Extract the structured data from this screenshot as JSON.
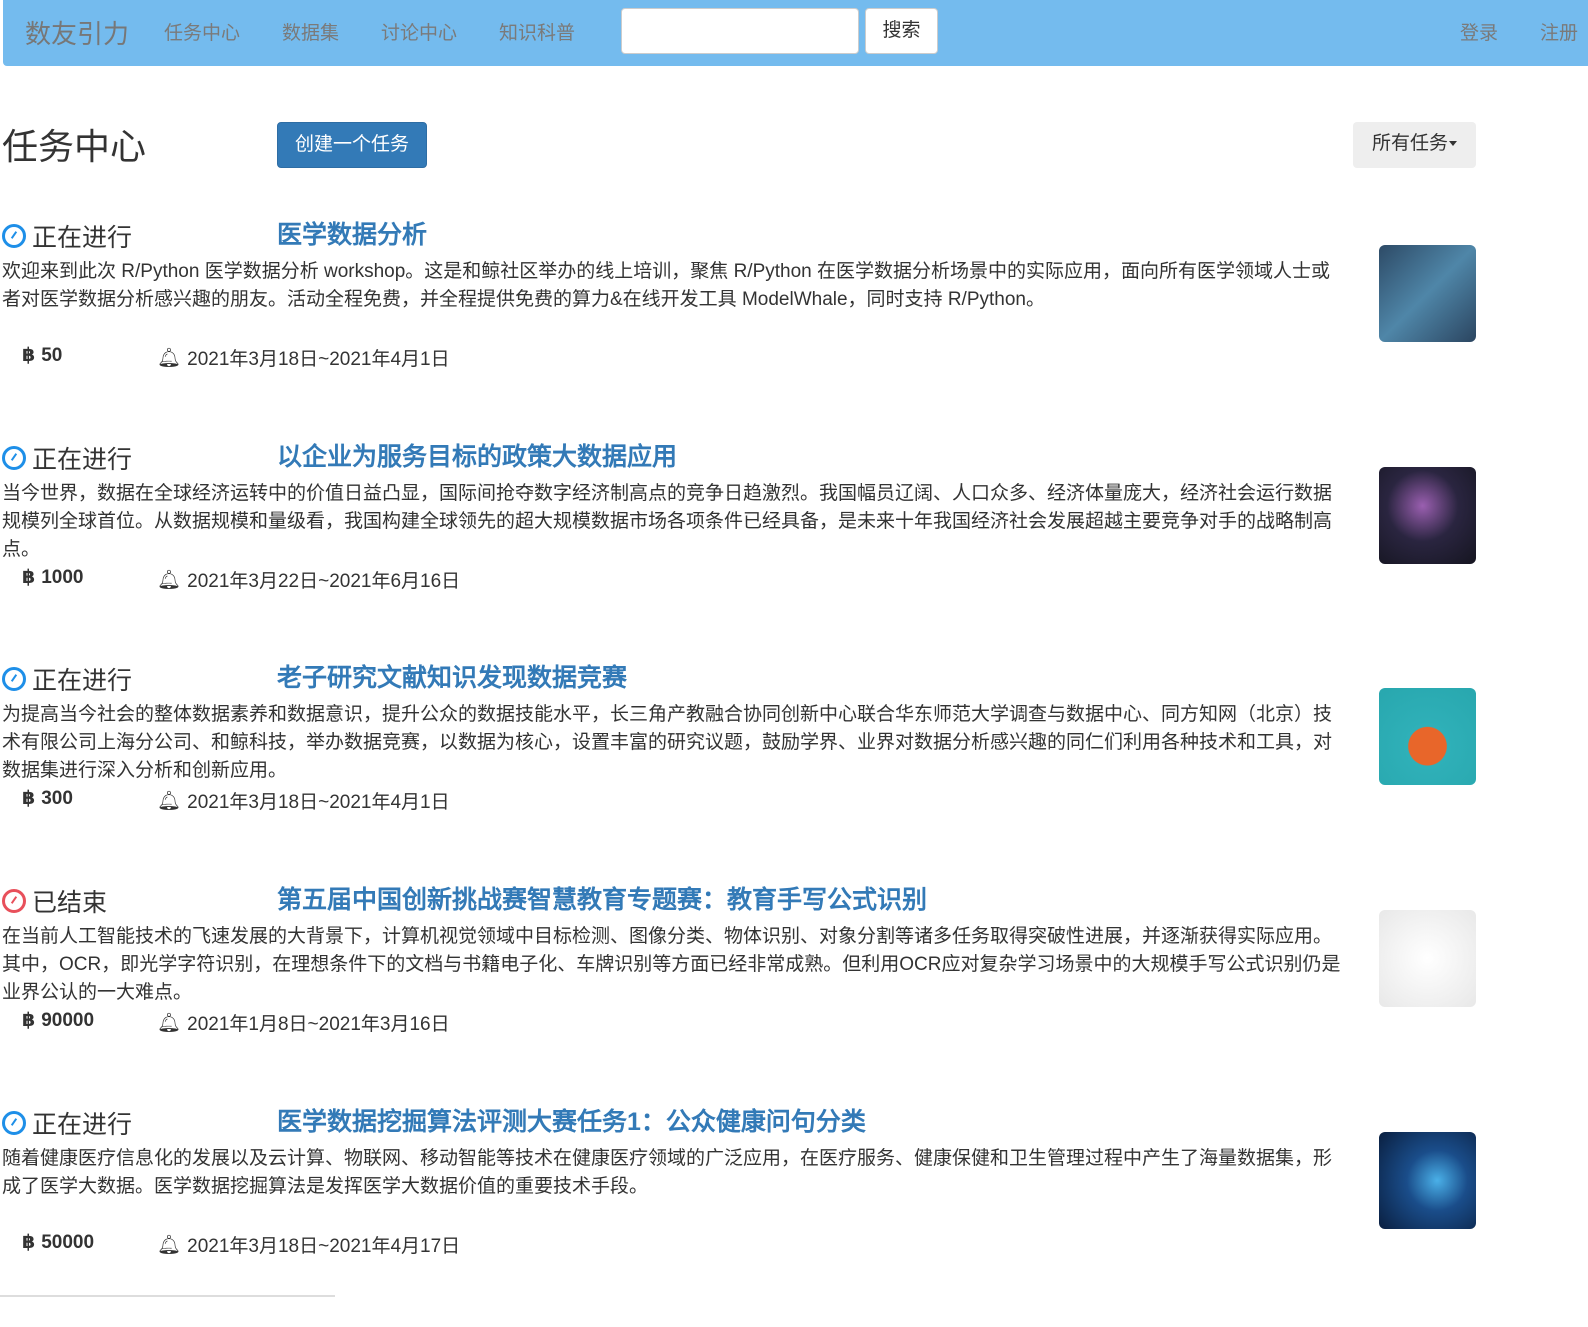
{
  "nav": {
    "brand": "数友引力",
    "links": [
      "任务中心",
      "数据集",
      "讨论中心",
      "知识科普"
    ],
    "search_value": "",
    "search_button": "搜索",
    "login": "登录",
    "register": "注册"
  },
  "page": {
    "title": "任务中心",
    "create_button": "创建一个任务",
    "filter_label": "所有任务"
  },
  "tasks": [
    {
      "status": "正在进行",
      "status_color": "#1e8fe8",
      "title": "医学数据分析",
      "desc": "欢迎来到此次 R/Python 医学数据分析 workshop。这是和鲸社区举办的线上培训，聚焦 R/Python 在医学数据分析场景中的实际应用，面向所有医学领域人士或者对医学数据分析感兴趣的朋友。活动全程免费，并全程提供免费的算力&在线开发工具 ModelWhale，同时支持 R/Python。",
      "reward": "50",
      "date": "2021年3月18日~2021年4月1日"
    },
    {
      "status": "正在进行",
      "status_color": "#1e8fe8",
      "title": "以企业为服务目标的政策大数据应用",
      "desc": "当今世界，数据在全球经济运转中的价值日益凸显，国际间抢夺数字经济制高点的竞争日趋激烈。我国幅员辽阔、人口众多、经济体量庞大，经济社会运行数据规模列全球首位。从数据规模和量级看，我国构建全球领先的超大规模数据市场各项条件已经具备，是未来十年我国经济社会发展超越主要竞争对手的战略制高点。",
      "reward": "1000",
      "date": "2021年3月22日~2021年6月16日"
    },
    {
      "status": "正在进行",
      "status_color": "#1e8fe8",
      "title": "老子研究文献知识发现数据竞赛",
      "desc": "为提高当今社会的整体数据素养和数据意识，提升公众的数据技能水平，长三角产教融合协同创新中心联合华东师范大学调查与数据中心、同方知网（北京）技术有限公司上海分公司、和鲸科技，举办数据竞赛，以数据为核心，设置丰富的研究议题，鼓励学界、业界对数据分析感兴趣的同仁们利用各种技术和工具，对数据集进行深入分析和创新应用。",
      "reward": "300",
      "date": "2021年3月18日~2021年4月1日"
    },
    {
      "status": "已结束",
      "status_color": "#e8505b",
      "title": "第五届中国创新挑战赛智慧教育专题赛：教育手写公式识别",
      "desc": "在当前人工智能技术的飞速发展的大背景下，计算机视觉领域中目标检测、图像分类、物体识别、对象分割等诸多任务取得突破性进展，并逐渐获得实际应用。其中，OCR，即光学字符识别，在理想条件下的文档与书籍电子化、车牌识别等方面已经非常成熟。但利用OCR应对复杂学习场景中的大规模手写公式识别仍是业界公认的一大难点。",
      "reward": "90000",
      "date": "2021年1月8日~2021年3月16日"
    },
    {
      "status": "正在进行",
      "status_color": "#1e8fe8",
      "title": "医学数据挖掘算法评测大赛任务1：公众健康问句分类",
      "desc": "随着健康医疗信息化的发展以及云计算、物联网、移动智能等技术在健康医疗领域的广泛应用，在医疗服务、健康保健和卫生管理过程中产生了海量数据集，形成了医学大数据。医学数据挖掘算法是发挥医学大数据价值的重要技术手段。",
      "reward": "50000",
      "date": "2021年3月18日~2021年4月17日"
    }
  ]
}
